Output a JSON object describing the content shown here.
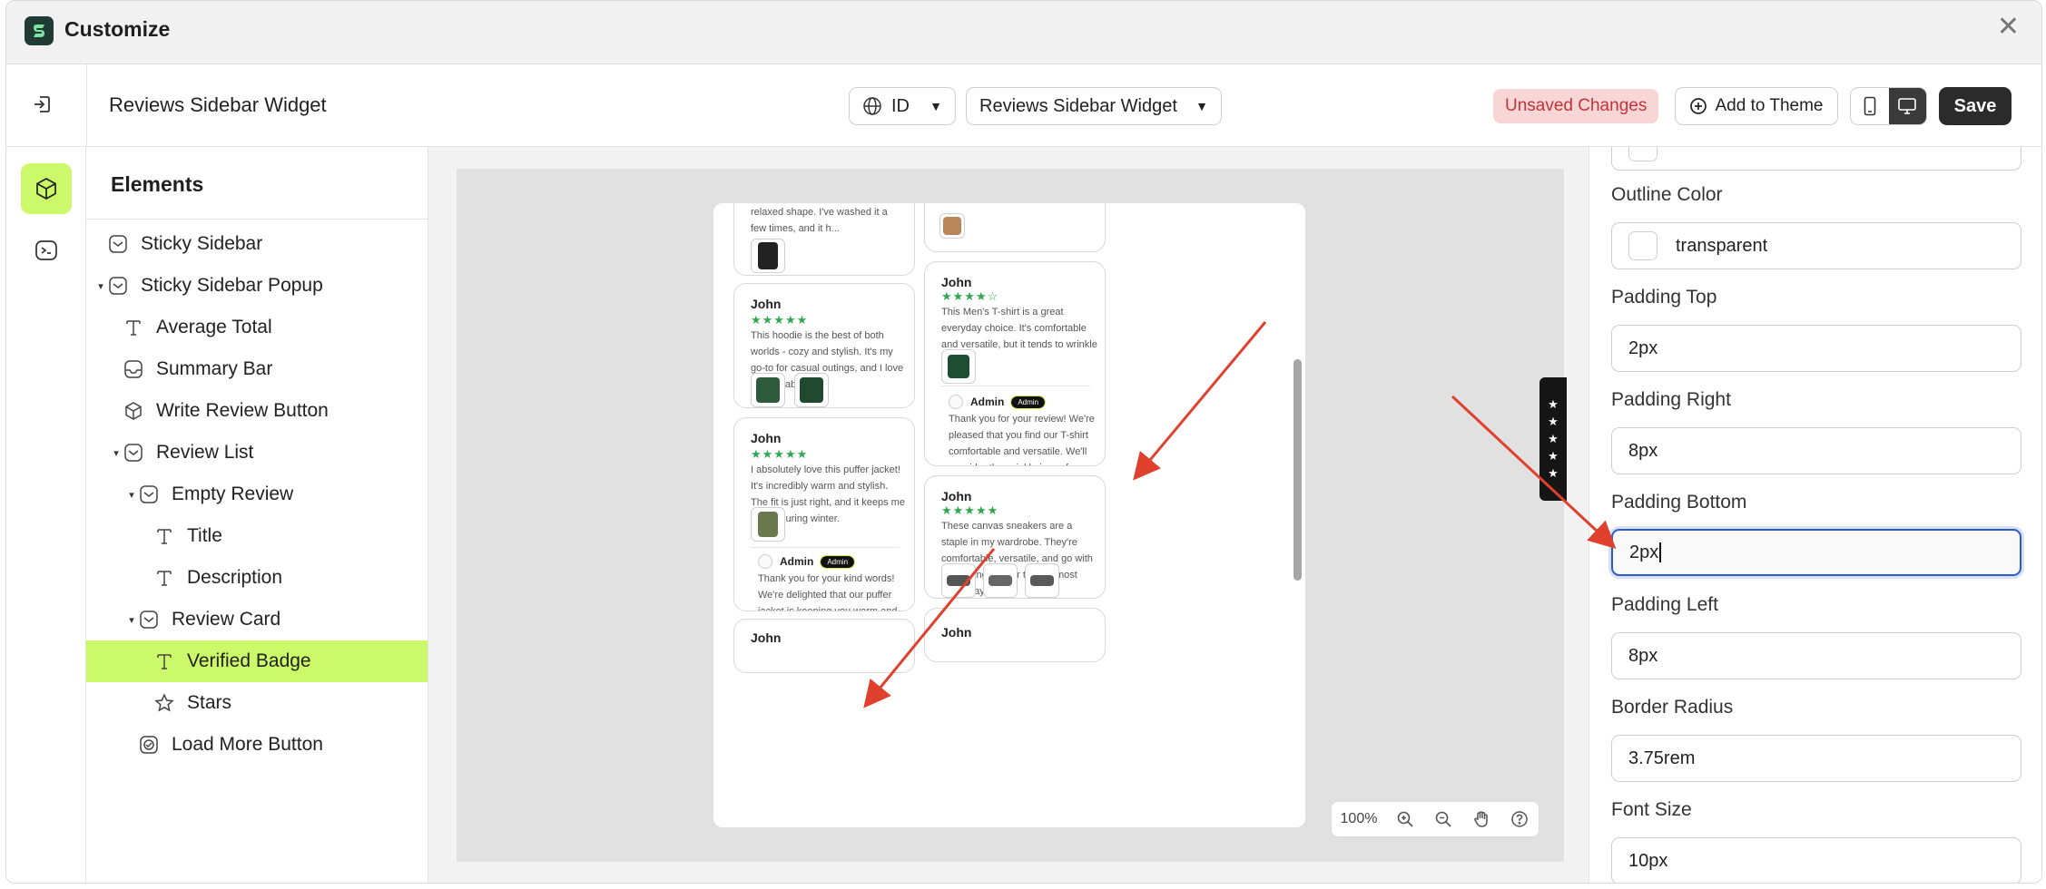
{
  "window": {
    "title": "Customize"
  },
  "topbar": {
    "widget_name": "Reviews Sidebar Widget",
    "language": "ID",
    "widget_select": "Reviews Sidebar Widget",
    "unsaved": "Unsaved Changes",
    "add_to_theme": "Add to Theme",
    "save": "Save"
  },
  "elements_panel": {
    "title": "Elements",
    "items": [
      {
        "label": "Sticky Sidebar",
        "icon": "section-icon"
      },
      {
        "label": "Sticky Sidebar Popup",
        "icon": "section-icon"
      },
      {
        "label": "Average Total",
        "icon": "text-icon"
      },
      {
        "label": "Summary Bar",
        "icon": "summary-icon"
      },
      {
        "label": "Write Review Button",
        "icon": "cube-icon"
      },
      {
        "label": "Review List",
        "icon": "section-icon"
      },
      {
        "label": "Empty Review",
        "icon": "section-icon"
      },
      {
        "label": "Title",
        "icon": "text-icon"
      },
      {
        "label": "Description",
        "icon": "text-icon"
      },
      {
        "label": "Review Card",
        "icon": "section-icon"
      },
      {
        "label": "Verified Badge",
        "icon": "text-icon"
      },
      {
        "label": "Stars",
        "icon": "star-icon"
      },
      {
        "label": "Load More Button",
        "icon": "button-icon"
      }
    ]
  },
  "preview": {
    "card_top_left_text": "relaxed shape. I've washed it a few times, and it h...",
    "reviews": [
      {
        "name": "John",
        "stars": "★★★★★",
        "text": "This hoodie is the best of both worlds - cozy and stylish. It's my go-to for casual outings, and I love its soft fabric."
      },
      {
        "name": "John",
        "stars": "★★★★★",
        "text": "I absolutely love this puffer jacket! It's incredibly warm and stylish. The fit is just right, and it keeps me toasty during winter.",
        "admin": "Admin",
        "badge": "Admin",
        "reply": "Thank you for your kind words! We're delighted that our puffer jacket is keeping you warm and stylish."
      },
      {
        "name": "John",
        "stars": "★★★★☆",
        "text": "This Men's T-shirt is a great everyday choice. It's comfortable and versatile, but it tends to wrinkle easily.",
        "admin": "Admin",
        "badge": "Admin",
        "reply": "Thank you for your review! We're pleased that you find our T-shirt comfortable and versatile. We'll consider the wrinkle issue for future improvements."
      },
      {
        "name": "John",
        "stars": "★★★★★",
        "text": "These canvas sneakers are a staple in my wardrobe. They're comfortable, versatile, and go with everything. I wear them almost every day!"
      },
      {
        "name": "John"
      },
      {
        "name": "John"
      }
    ],
    "zoom": "100%"
  },
  "settings": {
    "outline_color_label": "Outline Color",
    "outline_color_value": "transparent",
    "padding_top_label": "Padding Top",
    "padding_top_value": "2px",
    "padding_right_label": "Padding Right",
    "padding_right_value": "8px",
    "padding_bottom_label": "Padding Bottom",
    "padding_bottom_value": "2px",
    "padding_left_label": "Padding Left",
    "padding_left_value": "8px",
    "border_radius_label": "Border Radius",
    "border_radius_value": "3.75rem",
    "font_size_label": "Font Size",
    "font_size_value": "10px"
  },
  "colors": {
    "accent_green": "#ccf96a",
    "star_green": "#2fa84f",
    "unsaved_bg": "#f8d6d6",
    "unsaved_text": "#c2343b",
    "focus_blue": "#2c5cc9",
    "arrow_red": "#e0402e"
  }
}
